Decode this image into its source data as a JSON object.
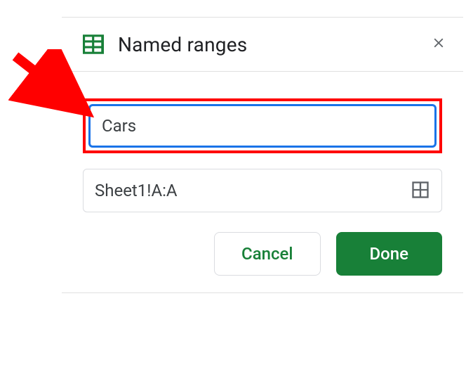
{
  "header": {
    "title": "Named ranges"
  },
  "form": {
    "name_value": "Cars",
    "range_value": "Sheet1!A:A"
  },
  "actions": {
    "cancel_label": "Cancel",
    "done_label": "Done"
  },
  "colors": {
    "annotation_red": "#ff0000",
    "primary_green": "#188038",
    "focus_blue": "#1a73e8"
  }
}
